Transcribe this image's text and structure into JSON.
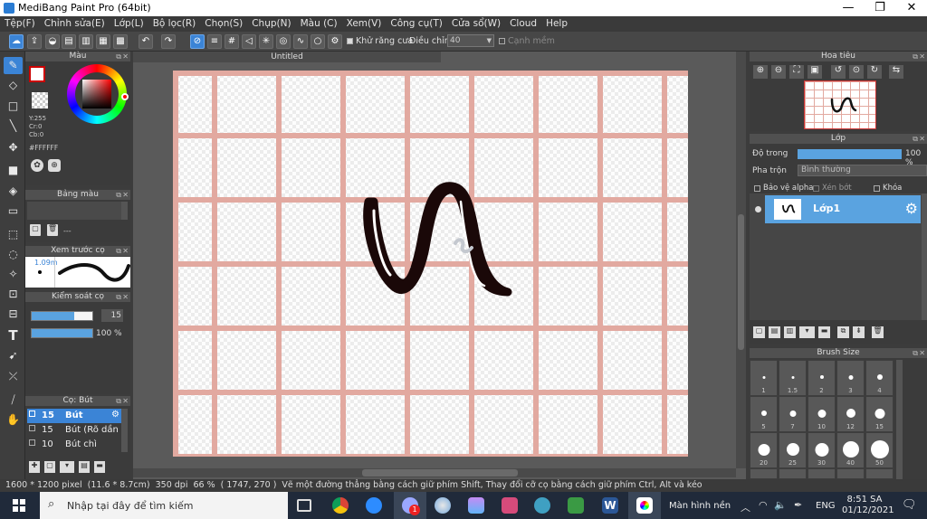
{
  "window": {
    "title": "MediBang Paint Pro (64bit)"
  },
  "menu": [
    "Tệp(F)",
    "Chỉnh sửa(E)",
    "Lớp(L)",
    "Bộ lọc(R)",
    "Chọn(S)",
    "Chụp(N)",
    "Màu (C)",
    "Xem(V)",
    "Công cụ(T)",
    "Cửa sổ(W)",
    "Cloud",
    "Help"
  ],
  "toolbar": {
    "antialias_label": "Khử răng cưa",
    "correction_label": "Điều chỉnh",
    "correction_value": "40",
    "smooth_edge_label": "Cạnh mềm"
  },
  "color_panel": {
    "title": "Màu",
    "y_label": "Y:255",
    "cr_label": "Cr:0",
    "cb_label": "Cb:0",
    "hex": "#FFFFFF"
  },
  "palette_panel": {
    "title": "Bảng màu",
    "dash": "---"
  },
  "brush_preview_panel": {
    "title": "Xem trước cọ",
    "size": "1.09m"
  },
  "brush_control_panel": {
    "title": "Kiểm soát cọ",
    "size_value": "15",
    "opacity_value": "100 %",
    "opacity_fraction": 1.0,
    "size_fraction": 0.7
  },
  "brush_list_panel": {
    "title": "Cọ: Bút",
    "items": [
      {
        "size": "15",
        "name": "Bút"
      },
      {
        "size": "15",
        "name": "Bút (Rõ dần"
      },
      {
        "size": "10",
        "name": "Bút chì"
      }
    ]
  },
  "document": {
    "tab": "Untitled"
  },
  "navigator_panel": {
    "title": "Hoa tiêu"
  },
  "layer_panel": {
    "title": "Lớp",
    "opacity_label": "Độ trong",
    "opacity_value": "100 %",
    "blend_label": "Pha trộn",
    "blend_value": "Bình thường",
    "protect_alpha": "Bảo vệ alpha",
    "clipping": "Xén bớt",
    "lock": "Khóa",
    "layers": [
      {
        "name": "Lớp1"
      }
    ]
  },
  "brush_size_panel": {
    "title": "Brush Size",
    "sizes": [
      "1",
      "1.5",
      "2",
      "3",
      "4",
      "5",
      "7",
      "10",
      "12",
      "15",
      "20",
      "25",
      "30",
      "40",
      "50"
    ]
  },
  "status": {
    "dimensions": "1600 * 1200 pixel",
    "size_cm": "(11.6 * 8.7cm)",
    "dpi": "350 dpi",
    "zoom": "66 %",
    "cursor": "( 1747, 270 )",
    "hint": "Vẽ một đường thẳng bằng cách giữ phím Shift, Thay đổi cỡ cọ bằng cách giữ phím Ctrl, Alt và kéo"
  },
  "taskbar": {
    "search_placeholder": "Nhập tại đây để tìm kiếm",
    "desktop_label": "Màn hình nền",
    "lang": "ENG",
    "time": "8:51 SA",
    "date": "01/12/2021",
    "notification_count": "1"
  },
  "colors": {
    "accent": "#3b84d6",
    "selected": "#5aa3e0",
    "grid": "#e2a9a0"
  }
}
